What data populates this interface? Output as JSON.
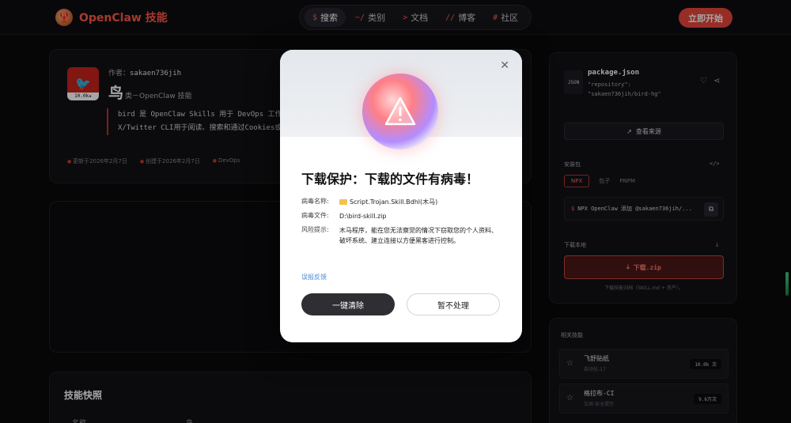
{
  "nav": {
    "brand": "OpenClaw 技能",
    "items": [
      {
        "prefix": "$",
        "label": "搜索",
        "active": true
      },
      {
        "prefix": "~/",
        "label": "类别",
        "active": false
      },
      {
        "prefix": ">",
        "label": "文档",
        "active": false
      },
      {
        "prefix": "//",
        "label": "博客",
        "active": false
      },
      {
        "prefix": "#",
        "label": "社区",
        "active": false
      }
    ],
    "cta": "立即开始"
  },
  "skill": {
    "author_label": "作者：",
    "author": "sakaen736jih",
    "badge": "10.0k★",
    "title_main": "鸟",
    "title_sub": "类－OpenClaw 技能",
    "description": "bird 是 OpenClaw Skills 用于 DevOps 工作流程的... X/Twitter CLI用于阅读、搜索和通过Cookies或Sweetist...",
    "meta": [
      "更新于2026年2月7日",
      "创建于2026年2月7日",
      "DevOps"
    ]
  },
  "snapshot": {
    "title": "技能快照",
    "col1": "名称",
    "col2": "鸟"
  },
  "package": {
    "icon_text": "JSON",
    "name": "package.json",
    "repo": "\"repository\": \"sakaen736jih/bird-hg\"",
    "source_button": "查看来源",
    "install_label": "安装包",
    "tabs": [
      "NPX",
      "包子",
      "PNPM"
    ],
    "cmd_prefix": "$",
    "command": "NPX OpenClaw 添加 @sakaen736jih/...",
    "download_label": "下载本地",
    "download_button": "下载.zip",
    "download_note": "下载技能归档（SKILL.md + 资产）。"
  },
  "related": {
    "label": "相关技能",
    "items": [
      {
        "title": "飞舒贴纸",
        "sub": "自动化-17",
        "count": "10.0k 次"
      },
      {
        "title": "格拉布-CI",
        "sub": "又闻-安全提示",
        "count": "9.6万次"
      }
    ]
  },
  "modal": {
    "title": "下载保护：下载的文件有病毒！",
    "virus_label": "病毒名称:",
    "virus_name": "Script.Trojan.Skill.Bdhl(木马)",
    "file_label": "病毒文件:",
    "file_path": "D:\\bird-skill.zip",
    "risk_label": "风险提示:",
    "risk_text": "木马程序，能在您无法察觉的情况下窃取您的个人资料、破坏系统、建立连接以方便黑客进行控制。",
    "feedback": "误报反馈",
    "clean_button": "一键清除",
    "skip_button": "暂不处理"
  },
  "colors": {
    "accent": "#e8453b",
    "modal_dark_button": "#2e2e33",
    "link": "#4a8cd8"
  }
}
